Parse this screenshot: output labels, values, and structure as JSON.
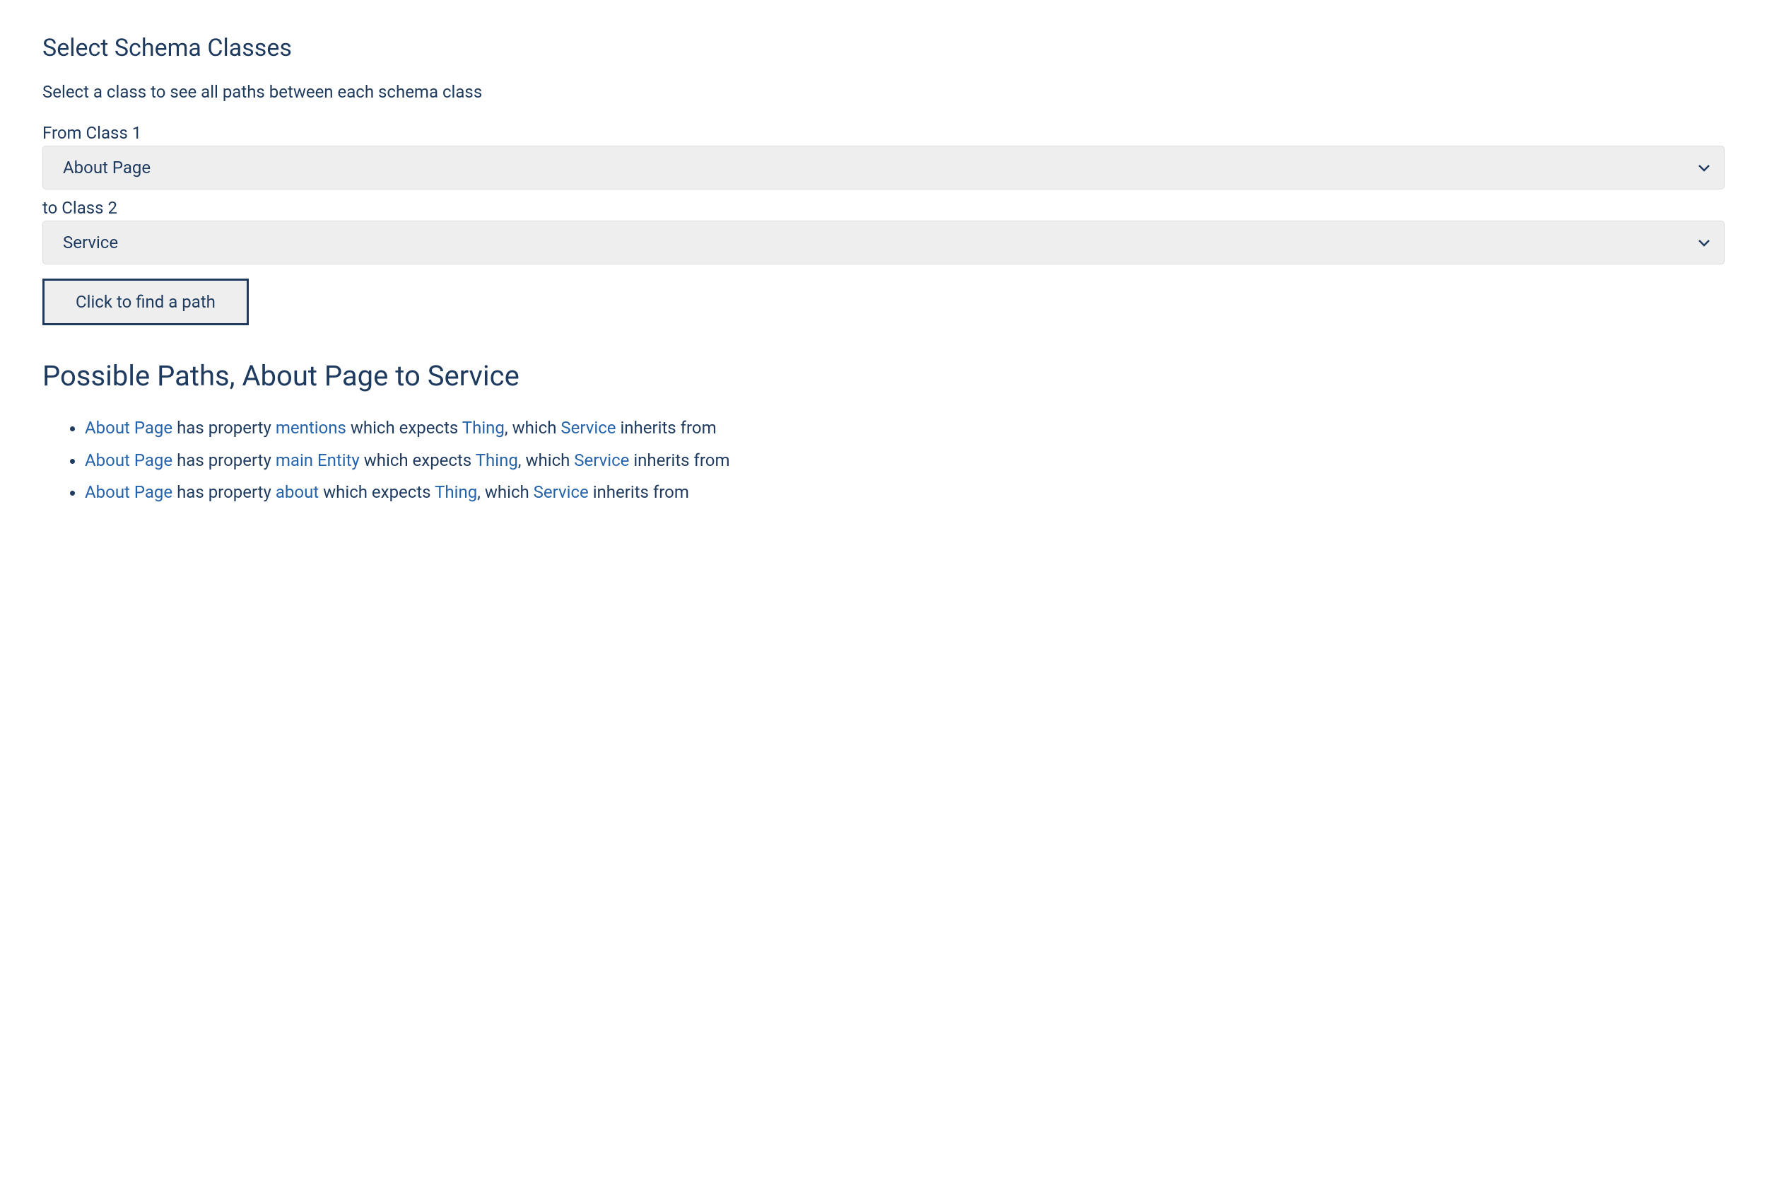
{
  "header": {
    "title": "Select Schema Classes",
    "description": "Select a class to see all paths between each schema class"
  },
  "form": {
    "label1": "From Class 1",
    "select1_value": "About Page",
    "label2": "to Class 2",
    "select2_value": "Service",
    "button_label": "Click to find a path"
  },
  "results": {
    "heading": "Possible Paths, About Page to Service",
    "paths": [
      {
        "from": "About Page",
        "t1": " has property ",
        "property": "mentions",
        "t2": " which expects ",
        "expects": "Thing",
        "t3": ", which ",
        "inherits": "Service",
        "t4": " inherits from"
      },
      {
        "from": "About Page",
        "t1": " has property ",
        "property": "main Entity",
        "t2": " which expects ",
        "expects": "Thing",
        "t3": ", which ",
        "inherits": "Service",
        "t4": " inherits from"
      },
      {
        "from": "About Page",
        "t1": " has property ",
        "property": "about",
        "t2": " which expects ",
        "expects": "Thing",
        "t3": ", which ",
        "inherits": "Service",
        "t4": " inherits from"
      }
    ]
  }
}
